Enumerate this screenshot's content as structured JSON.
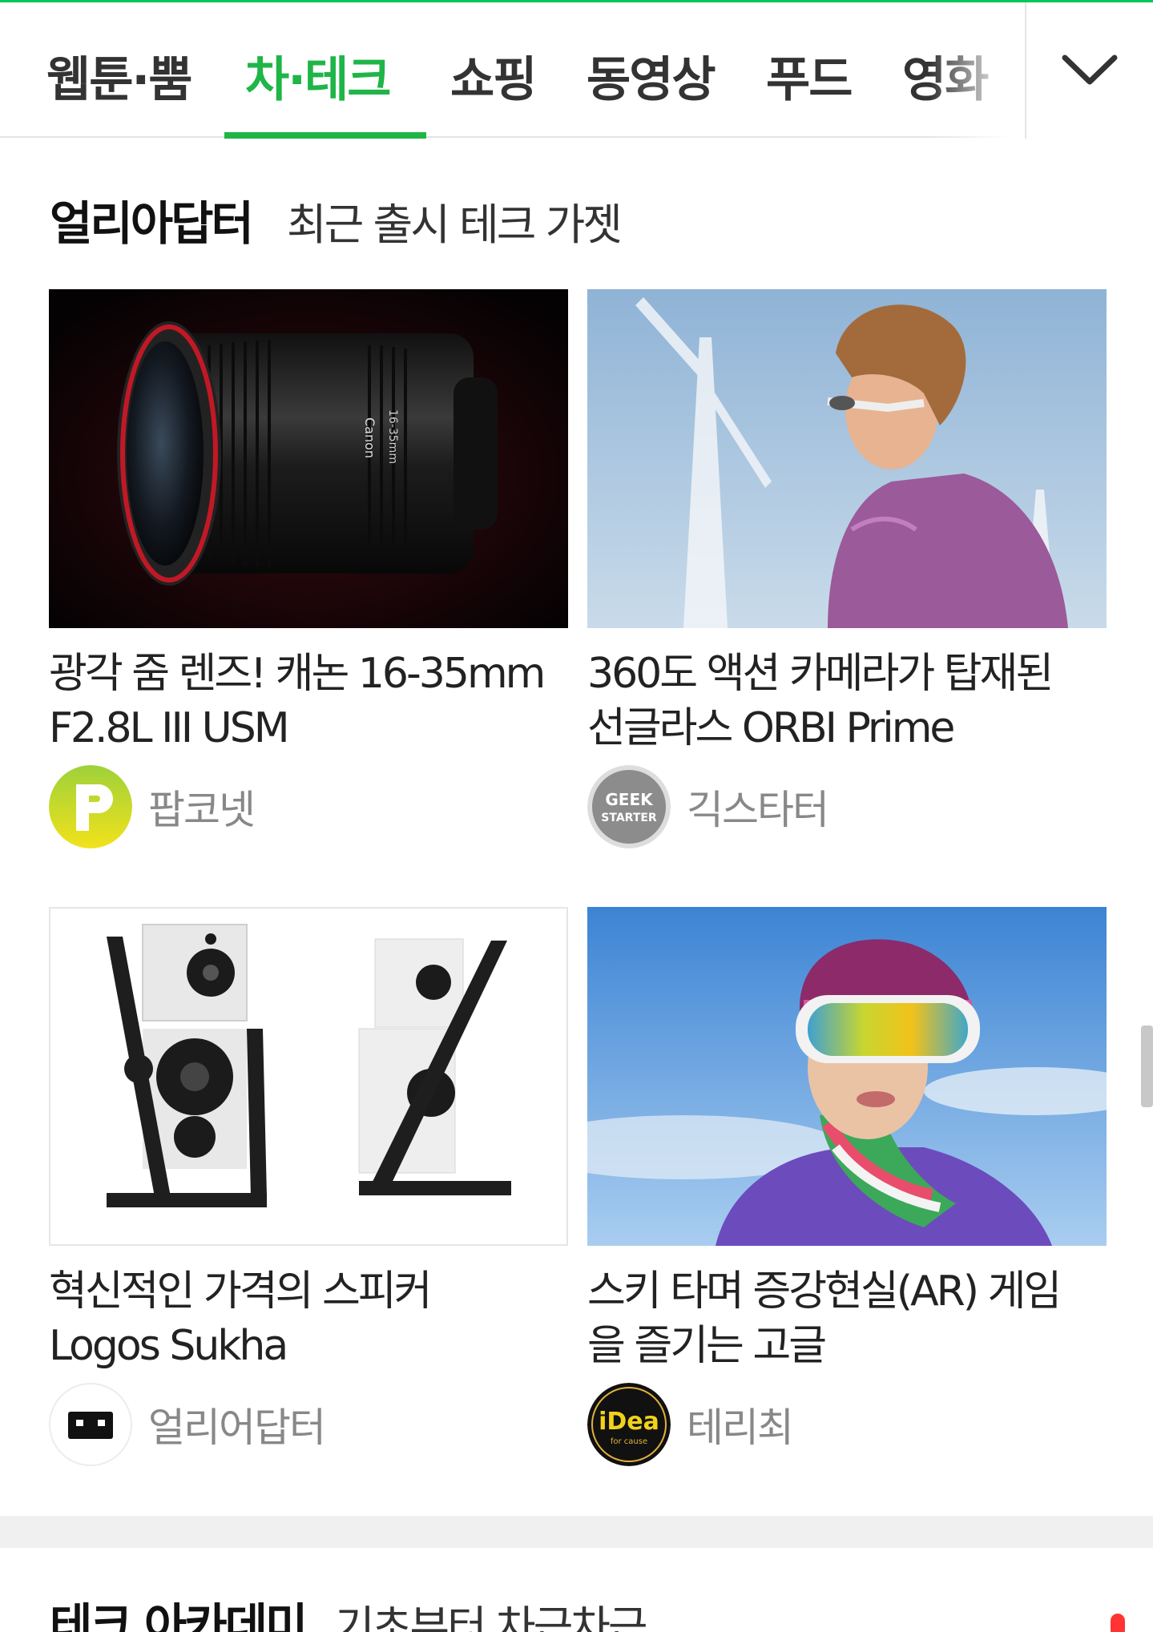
{
  "nav": {
    "tabs": [
      {
        "label": "웹툰·뿜"
      },
      {
        "label": "차·테크"
      },
      {
        "label": "쇼핑"
      },
      {
        "label": "동영상"
      },
      {
        "label": "푸드"
      },
      {
        "label": "영화"
      }
    ],
    "active_tab": "차·테크",
    "accent_color": "#1fb547",
    "dropdown_icon": "chevron-down-icon"
  },
  "section": {
    "title": "얼리아답터",
    "subtitle": "최근 출시 테크 가젯",
    "cards": [
      {
        "title_line1": "광각 줌 렌즈! 캐논 16-35mm",
        "title_line2": "F2.8L III USM",
        "source": "팝코넷",
        "source_logo": "popcornnet-logo"
      },
      {
        "title_line1": "360도 액션 카메라가 탑재된",
        "title_line2": "선글라스 ORBI Prime",
        "source": "긱스타터",
        "source_logo": "geekstarter-logo"
      },
      {
        "title_line1": "혁신적인 가격의 스피커",
        "title_line2": "Logos Sukha",
        "source": "얼리어답터",
        "source_logo": "earlyadopter-logo"
      },
      {
        "title_line1": "스키 타며 증강현실(AR) 게임",
        "title_line2": "을 즐기는 고글",
        "source": "테리최",
        "source_logo": "idea-logo"
      }
    ]
  },
  "section2": {
    "title": "테크 아카데미",
    "subtitle": "기초부터 차근차근"
  },
  "logos": {
    "geek_line1": "GEEK",
    "geek_line2": "STARTER",
    "idea_main": "iDea",
    "idea_sub": "for cause"
  },
  "lens_text": "16-35mm"
}
